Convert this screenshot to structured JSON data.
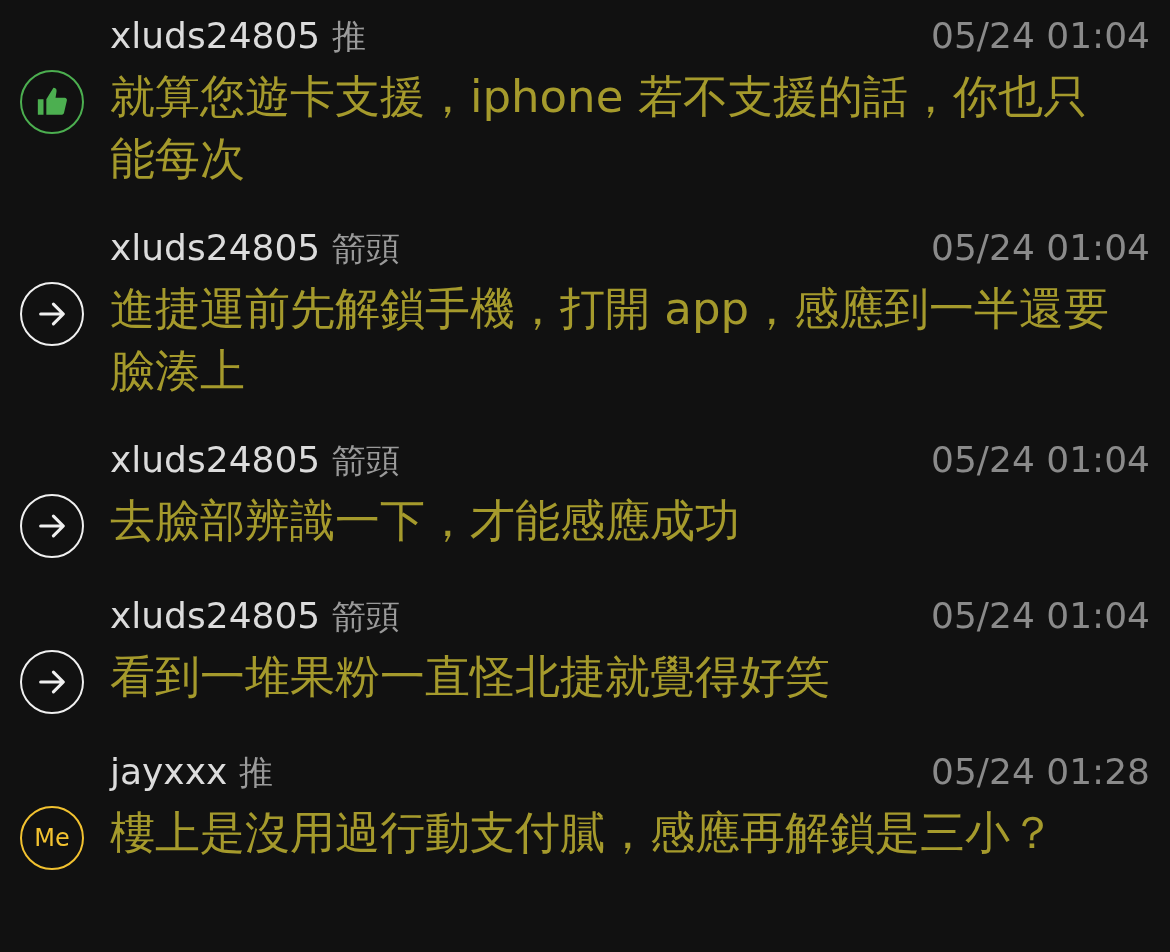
{
  "comments": [
    {
      "kind": "push",
      "user": "xluds24805",
      "tag": "推",
      "time": "05/24 01:04",
      "text": "就算您遊卡支援，iphone 若不支援的話，你也只能每次"
    },
    {
      "kind": "arrow",
      "user": "xluds24805",
      "tag": "箭頭",
      "time": "05/24 01:04",
      "text": "進捷運前先解鎖手機，打開 app，感應到一半還要臉湊上"
    },
    {
      "kind": "arrow",
      "user": "xluds24805",
      "tag": "箭頭",
      "time": "05/24 01:04",
      "text": "去臉部辨識一下，才能感應成功"
    },
    {
      "kind": "arrow",
      "user": "xluds24805",
      "tag": "箭頭",
      "time": "05/24 01:04",
      "text": "看到一堆果粉一直怪北捷就覺得好笑"
    },
    {
      "kind": "me",
      "badge": "Me",
      "user": "jayxxx",
      "tag": "推",
      "time": "05/24 01:28",
      "text": "樓上是沒用過行動支付膩，感應再解鎖是三小？"
    }
  ]
}
